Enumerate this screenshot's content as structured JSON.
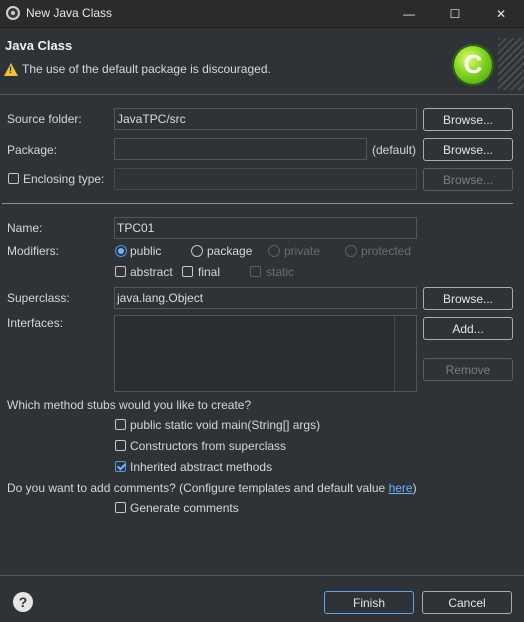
{
  "window": {
    "title": "New Java Class",
    "minimize": "—",
    "maximize": "☐",
    "close": "✕"
  },
  "header": {
    "title": "Java Class",
    "warning": "The use of the default package is discouraged.",
    "logo_letter": "C"
  },
  "source_folder": {
    "label": "Source folder:",
    "value": "JavaTPC/src",
    "browse": "Browse..."
  },
  "package": {
    "label": "Package:",
    "value": "",
    "default_hint": "(default)",
    "browse": "Browse..."
  },
  "enclosing_type": {
    "label": "Enclosing type:",
    "value": "",
    "browse": "Browse...",
    "checked": false
  },
  "name": {
    "label": "Name:",
    "value": "TPC01"
  },
  "modifiers": {
    "label": "Modifiers:",
    "access": [
      {
        "label": "public",
        "selected": true,
        "enabled": true
      },
      {
        "label": "package",
        "selected": false,
        "enabled": true
      },
      {
        "label": "private",
        "selected": false,
        "enabled": false
      },
      {
        "label": "protected",
        "selected": false,
        "enabled": false
      }
    ],
    "flags": [
      {
        "label": "abstract",
        "checked": false,
        "enabled": true
      },
      {
        "label": "final",
        "checked": false,
        "enabled": true
      },
      {
        "label": "static",
        "checked": false,
        "enabled": false
      }
    ]
  },
  "superclass": {
    "label": "Superclass:",
    "value": "java.lang.Object",
    "browse": "Browse..."
  },
  "interfaces": {
    "label": "Interfaces:",
    "add": "Add...",
    "remove": "Remove"
  },
  "stubs": {
    "question": "Which method stubs would you like to create?",
    "options": [
      {
        "label": "public static void main(String[] args)",
        "checked": false
      },
      {
        "label": "Constructors from superclass",
        "checked": false
      },
      {
        "label": "Inherited abstract methods",
        "checked": true
      }
    ]
  },
  "comments": {
    "question_prefix": "Do you want to add comments? (Configure templates and default value ",
    "link": "here",
    "question_suffix": ")",
    "generate_label": "Generate comments",
    "checked": false
  },
  "footer": {
    "help": "?",
    "finish": "Finish",
    "cancel": "Cancel"
  },
  "colors": {
    "background": "#2f3236",
    "accent": "#6fb3ff",
    "logo_green": "#7dd01f",
    "warning": "#f2c033"
  }
}
